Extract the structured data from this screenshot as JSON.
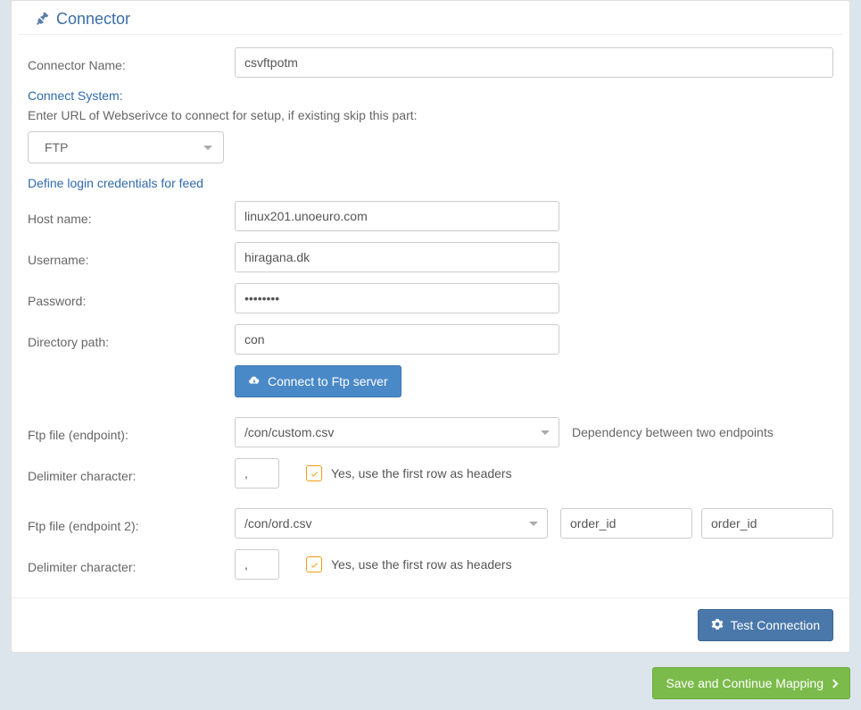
{
  "header": {
    "title": "Connector",
    "icon": "plug-icon"
  },
  "fields": {
    "connector_name_label": "Connector Name:",
    "connector_name_value": "csvftpotm",
    "connect_system_label": "Connect System:",
    "setup_hint": "Enter URL of Webserivce to connect for setup, if existing skip this part:",
    "protocol_value": "FTP",
    "define_login_label": "Define login credentials for feed",
    "host_label": "Host name:",
    "host_value": "linux201.unoeuro.com",
    "username_label": "Username:",
    "username_value": "hiragana.dk",
    "password_label": "Password:",
    "password_value": "••••••••",
    "dirpath_label": "Directory path:",
    "dirpath_value": "con",
    "connect_ftp_button": "Connect to Ftp server",
    "endpoint1_label": "Ftp file (endpoint):",
    "endpoint1_value": "/con/custom.csv",
    "dependency_text": "Dependency between two endpoints",
    "delimiter_label": "Delimiter character:",
    "delimiter1_value": ",",
    "headers_checkbox_label": "Yes, use the first row as headers",
    "endpoint2_label": "Ftp file (endpoint 2):",
    "endpoint2_value": "/con/ord.csv",
    "dep_field1_value": "order_id",
    "dep_field2_value": "order_id",
    "delimiter2_value": ","
  },
  "footer": {
    "test_connection_label": "Test Connection",
    "save_continue_label": "Save and Continue Mapping"
  }
}
